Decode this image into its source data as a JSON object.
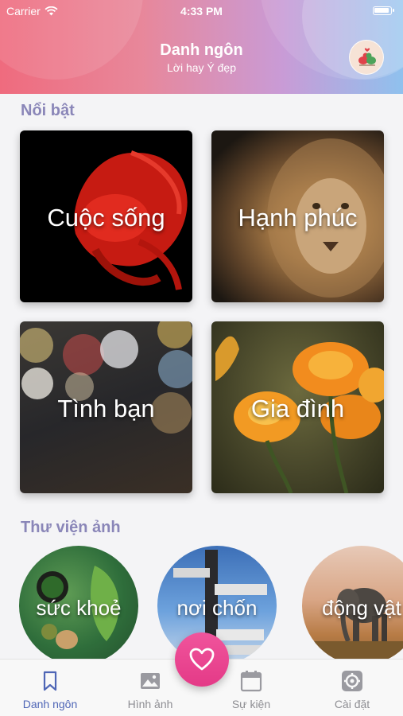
{
  "status": {
    "carrier": "Carrier",
    "time": "4:33 PM"
  },
  "header": {
    "title": "Danh ngôn",
    "subtitle": "Lời hay Ý đẹp"
  },
  "featured": {
    "title": "Nổi bật",
    "cards": [
      {
        "label": "Cuộc sống"
      },
      {
        "label": "Hạnh phúc"
      },
      {
        "label": "Tình bạn"
      },
      {
        "label": "Gia đình"
      }
    ]
  },
  "gallery": {
    "title": "Thư viện ảnh",
    "items": [
      {
        "label": "sức khoẻ"
      },
      {
        "label": "nơi chốn"
      },
      {
        "label": "động vật"
      }
    ]
  },
  "tabbar": {
    "tabs": [
      {
        "label": "Danh ngôn",
        "icon": "bookmark-icon",
        "active": true
      },
      {
        "label": "Hình ảnh",
        "icon": "image-icon",
        "active": false
      },
      {
        "label": "Sự kiện",
        "icon": "calendar-icon",
        "active": false
      },
      {
        "label": "Cài đặt",
        "icon": "gear-icon",
        "active": false
      }
    ],
    "fab_icon": "heart-icon"
  },
  "colors": {
    "accent": "#4f66b6",
    "section_title": "#8a86b8",
    "fab": "#e84591"
  }
}
